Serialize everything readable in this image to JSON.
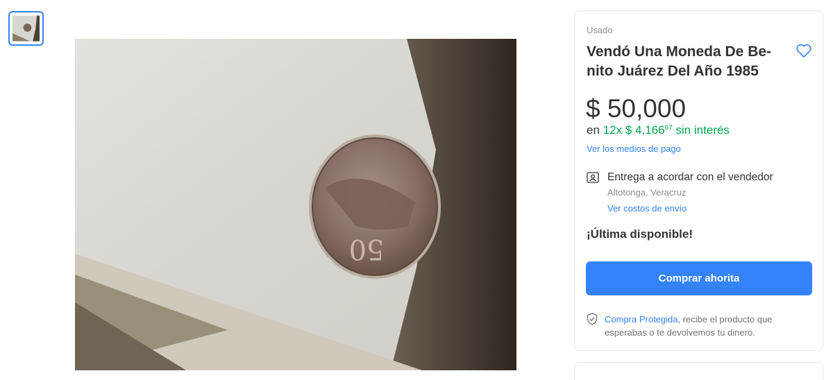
{
  "product": {
    "condition": "Usado",
    "title": "Vendó Una Moneda De Be-nito Juárez Del Año 1985",
    "price": "$ 50,000",
    "installments": {
      "prefix": "en",
      "count": "12x",
      "amount": "$ 4,166",
      "cents": "67",
      "suffix": "sin interés"
    },
    "payment_methods_link": "Ver los medios de pago",
    "delivery": {
      "title": "Entrega a acordar con el vendedor",
      "location": "Altotonga, Veracruz",
      "shipping_link": "Ver costos de envío"
    },
    "stock_status": "¡Última disponible!",
    "buy_button": "Comprar ahorita",
    "protection": {
      "link": "Compra Protegida",
      "text": ", recibe el producto que esperabas o te devolvemos tu dinero."
    }
  },
  "colors": {
    "accent": "#3483fa",
    "green": "#00a650",
    "text": "#333333",
    "muted": "#8c8c8c"
  },
  "icons": [
    "heart-icon",
    "delivery-person-icon",
    "shield-check-icon"
  ]
}
